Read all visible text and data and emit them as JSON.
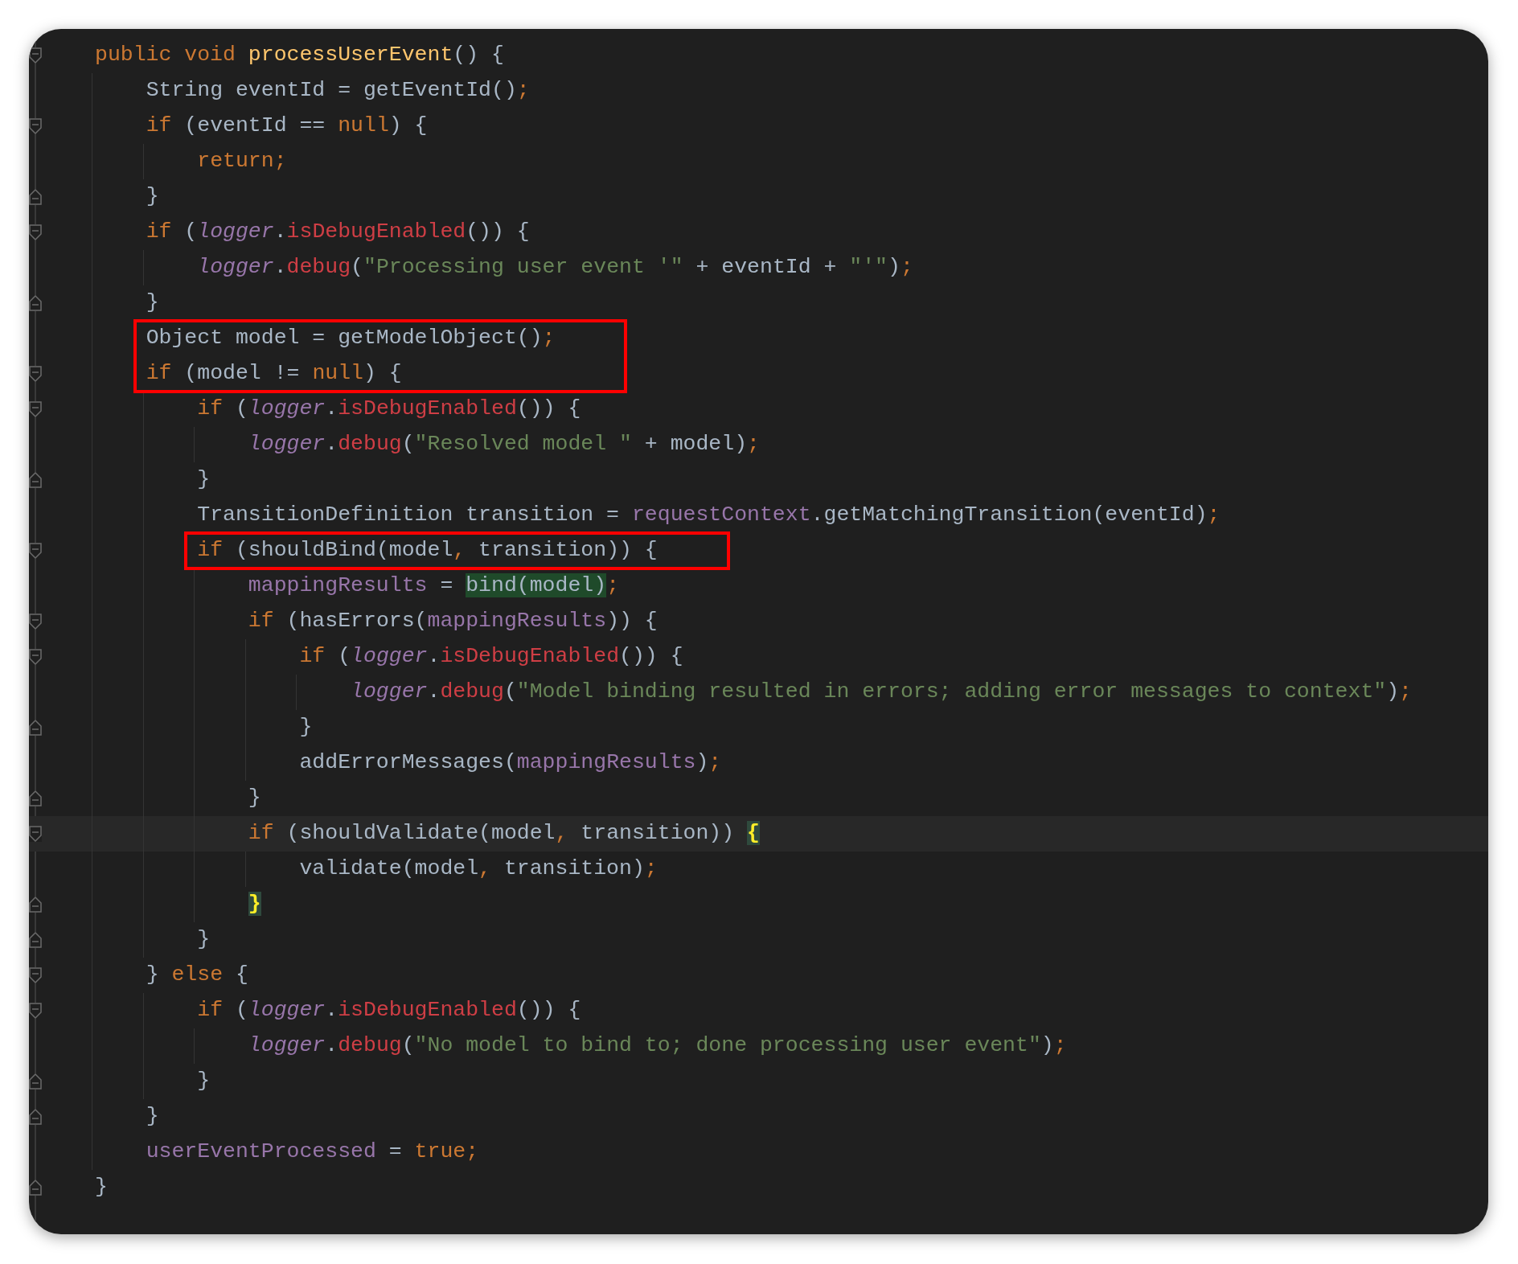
{
  "editor": {
    "lines": [
      {
        "fold_start": true,
        "fold_end": false,
        "boxed": false,
        "current": false,
        "tokens": [
          {
            "text": "public void ",
            "kind": "keyword"
          },
          {
            "text": "processUserEvent",
            "kind": "declaration"
          },
          {
            "text": "() {",
            "kind": "plain"
          }
        ]
      },
      {
        "fold_start": false,
        "fold_end": false,
        "boxed": false,
        "current": false,
        "tokens": [
          {
            "text": "    String eventId = getEventId()",
            "kind": "plain"
          },
          {
            "text": ";",
            "kind": "keyword"
          }
        ]
      },
      {
        "fold_start": true,
        "fold_end": false,
        "boxed": false,
        "current": false,
        "tokens": [
          {
            "text": "    if",
            "kind": "keyword"
          },
          {
            "text": " (eventId == ",
            "kind": "plain"
          },
          {
            "text": "null",
            "kind": "keyword"
          },
          {
            "text": ") {",
            "kind": "plain"
          }
        ]
      },
      {
        "fold_start": false,
        "fold_end": false,
        "boxed": false,
        "current": false,
        "tokens": [
          {
            "text": "        return;",
            "kind": "keyword"
          }
        ]
      },
      {
        "fold_start": false,
        "fold_end": true,
        "boxed": false,
        "current": false,
        "tokens": [
          {
            "text": "    }",
            "kind": "plain"
          }
        ]
      },
      {
        "fold_start": true,
        "fold_end": false,
        "boxed": false,
        "current": false,
        "tokens": [
          {
            "text": "    if",
            "kind": "keyword"
          },
          {
            "text": " (",
            "kind": "plain"
          },
          {
            "text": "logger",
            "kind": "static_field"
          },
          {
            "text": ".",
            "kind": "plain"
          },
          {
            "text": "isDebugEnabled",
            "kind": "call"
          },
          {
            "text": "()) {",
            "kind": "plain"
          }
        ]
      },
      {
        "fold_start": false,
        "fold_end": false,
        "boxed": false,
        "current": false,
        "tokens": [
          {
            "text": "        logger",
            "kind": "static_field"
          },
          {
            "text": ".",
            "kind": "plain"
          },
          {
            "text": "debug",
            "kind": "call"
          },
          {
            "text": "(",
            "kind": "plain"
          },
          {
            "text": "\"Processing user event '\"",
            "kind": "string"
          },
          {
            "text": " + eventId + ",
            "kind": "plain"
          },
          {
            "text": "\"'\"",
            "kind": "string"
          },
          {
            "text": ")",
            "kind": "plain"
          },
          {
            "text": ";",
            "kind": "keyword"
          }
        ]
      },
      {
        "fold_start": false,
        "fold_end": true,
        "boxed": false,
        "current": false,
        "tokens": [
          {
            "text": "    }",
            "kind": "plain"
          }
        ]
      },
      {
        "fold_start": false,
        "fold_end": false,
        "boxed": true,
        "current": false,
        "tokens": [
          {
            "text": "    Object model = getModelObject()",
            "kind": "plain"
          },
          {
            "text": ";",
            "kind": "keyword"
          }
        ]
      },
      {
        "fold_start": true,
        "fold_end": false,
        "boxed": true,
        "current": false,
        "tokens": [
          {
            "text": "    if",
            "kind": "keyword"
          },
          {
            "text": " (model != ",
            "kind": "plain"
          },
          {
            "text": "null",
            "kind": "keyword"
          },
          {
            "text": ") {",
            "kind": "plain"
          }
        ]
      },
      {
        "fold_start": true,
        "fold_end": false,
        "boxed": false,
        "current": false,
        "tokens": [
          {
            "text": "        if",
            "kind": "keyword"
          },
          {
            "text": " (",
            "kind": "plain"
          },
          {
            "text": "logger",
            "kind": "static_field"
          },
          {
            "text": ".",
            "kind": "plain"
          },
          {
            "text": "isDebugEnabled",
            "kind": "call"
          },
          {
            "text": "()) {",
            "kind": "plain"
          }
        ]
      },
      {
        "fold_start": false,
        "fold_end": false,
        "boxed": false,
        "current": false,
        "tokens": [
          {
            "text": "            logger",
            "kind": "static_field"
          },
          {
            "text": ".",
            "kind": "plain"
          },
          {
            "text": "debug",
            "kind": "call"
          },
          {
            "text": "(",
            "kind": "plain"
          },
          {
            "text": "\"Resolved model \"",
            "kind": "string"
          },
          {
            "text": " + model)",
            "kind": "plain"
          },
          {
            "text": ";",
            "kind": "keyword"
          }
        ]
      },
      {
        "fold_start": false,
        "fold_end": true,
        "boxed": false,
        "current": false,
        "tokens": [
          {
            "text": "        }",
            "kind": "plain"
          }
        ]
      },
      {
        "fold_start": false,
        "fold_end": false,
        "boxed": false,
        "current": false,
        "tokens": [
          {
            "text": "        TransitionDefinition transition = ",
            "kind": "plain"
          },
          {
            "text": "requestContext",
            "kind": "field"
          },
          {
            "text": ".getMatchingTransition(eventId)",
            "kind": "plain"
          },
          {
            "text": ";",
            "kind": "keyword"
          }
        ]
      },
      {
        "fold_start": true,
        "fold_end": false,
        "boxed": true,
        "current": false,
        "tokens": [
          {
            "text": "        if",
            "kind": "keyword"
          },
          {
            "text": " (shouldBind(model",
            "kind": "plain"
          },
          {
            "text": ",",
            "kind": "keyword"
          },
          {
            "text": " transition)) {",
            "kind": "plain"
          }
        ]
      },
      {
        "fold_start": false,
        "fold_end": false,
        "boxed": false,
        "current": false,
        "tokens": [
          {
            "text": "            mappingResults",
            "kind": "field"
          },
          {
            "text": " = ",
            "kind": "plain"
          },
          {
            "text": "bind(model)",
            "kind": "usage"
          },
          {
            "text": ";",
            "kind": "keyword"
          }
        ]
      },
      {
        "fold_start": true,
        "fold_end": false,
        "boxed": false,
        "current": false,
        "tokens": [
          {
            "text": "            if",
            "kind": "keyword"
          },
          {
            "text": " (hasErrors(",
            "kind": "plain"
          },
          {
            "text": "mappingResults",
            "kind": "field"
          },
          {
            "text": ")) {",
            "kind": "plain"
          }
        ]
      },
      {
        "fold_start": true,
        "fold_end": false,
        "boxed": false,
        "current": false,
        "tokens": [
          {
            "text": "                if",
            "kind": "keyword"
          },
          {
            "text": " (",
            "kind": "plain"
          },
          {
            "text": "logger",
            "kind": "static_field"
          },
          {
            "text": ".",
            "kind": "plain"
          },
          {
            "text": "isDebugEnabled",
            "kind": "call"
          },
          {
            "text": "()) {",
            "kind": "plain"
          }
        ]
      },
      {
        "fold_start": false,
        "fold_end": false,
        "boxed": false,
        "current": false,
        "tokens": [
          {
            "text": "                    logger",
            "kind": "static_field"
          },
          {
            "text": ".",
            "kind": "plain"
          },
          {
            "text": "debug",
            "kind": "call"
          },
          {
            "text": "(",
            "kind": "plain"
          },
          {
            "text": "\"Model binding resulted in errors; adding error messages to context\"",
            "kind": "string"
          },
          {
            "text": ")",
            "kind": "plain"
          },
          {
            "text": ";",
            "kind": "keyword"
          }
        ]
      },
      {
        "fold_start": false,
        "fold_end": true,
        "boxed": false,
        "current": false,
        "tokens": [
          {
            "text": "                }",
            "kind": "plain"
          }
        ]
      },
      {
        "fold_start": false,
        "fold_end": false,
        "boxed": false,
        "current": false,
        "tokens": [
          {
            "text": "                addErrorMessages(",
            "kind": "plain"
          },
          {
            "text": "mappingResults",
            "kind": "field"
          },
          {
            "text": ")",
            "kind": "plain"
          },
          {
            "text": ";",
            "kind": "keyword"
          }
        ]
      },
      {
        "fold_start": false,
        "fold_end": true,
        "boxed": false,
        "current": false,
        "tokens": [
          {
            "text": "            }",
            "kind": "plain"
          }
        ]
      },
      {
        "fold_start": true,
        "fold_end": false,
        "boxed": false,
        "current": true,
        "tokens": [
          {
            "text": "            if",
            "kind": "keyword"
          },
          {
            "text": " (shouldValidate(model",
            "kind": "plain"
          },
          {
            "text": ",",
            "kind": "keyword"
          },
          {
            "text": " transition)) ",
            "kind": "plain"
          },
          {
            "text": "{",
            "kind": "brace_match"
          }
        ]
      },
      {
        "fold_start": false,
        "fold_end": false,
        "boxed": false,
        "current": false,
        "tokens": [
          {
            "text": "                validate(model",
            "kind": "plain"
          },
          {
            "text": ",",
            "kind": "keyword"
          },
          {
            "text": " transition)",
            "kind": "plain"
          },
          {
            "text": ";",
            "kind": "keyword"
          }
        ]
      },
      {
        "fold_start": false,
        "fold_end": true,
        "boxed": false,
        "current": false,
        "tokens": [
          {
            "text": "            }",
            "kind": "brace_match"
          }
        ]
      },
      {
        "fold_start": false,
        "fold_end": true,
        "boxed": false,
        "current": false,
        "tokens": [
          {
            "text": "        }",
            "kind": "plain"
          }
        ]
      },
      {
        "fold_start": true,
        "fold_end": false,
        "boxed": false,
        "current": false,
        "tokens": [
          {
            "text": "    } ",
            "kind": "plain"
          },
          {
            "text": "else",
            "kind": "keyword"
          },
          {
            "text": " {",
            "kind": "plain"
          }
        ]
      },
      {
        "fold_start": true,
        "fold_end": false,
        "boxed": false,
        "current": false,
        "tokens": [
          {
            "text": "        if",
            "kind": "keyword"
          },
          {
            "text": " (",
            "kind": "plain"
          },
          {
            "text": "logger",
            "kind": "static_field"
          },
          {
            "text": ".",
            "kind": "plain"
          },
          {
            "text": "isDebugEnabled",
            "kind": "call"
          },
          {
            "text": "()) {",
            "kind": "plain"
          }
        ]
      },
      {
        "fold_start": false,
        "fold_end": false,
        "boxed": false,
        "current": false,
        "tokens": [
          {
            "text": "            logger",
            "kind": "static_field"
          },
          {
            "text": ".",
            "kind": "plain"
          },
          {
            "text": "debug",
            "kind": "call"
          },
          {
            "text": "(",
            "kind": "plain"
          },
          {
            "text": "\"No model to bind to; done processing user event\"",
            "kind": "string"
          },
          {
            "text": ")",
            "kind": "plain"
          },
          {
            "text": ";",
            "kind": "keyword"
          }
        ]
      },
      {
        "fold_start": false,
        "fold_end": true,
        "boxed": false,
        "current": false,
        "tokens": [
          {
            "text": "        }",
            "kind": "plain"
          }
        ]
      },
      {
        "fold_start": false,
        "fold_end": true,
        "boxed": false,
        "current": false,
        "tokens": [
          {
            "text": "    }",
            "kind": "plain"
          }
        ]
      },
      {
        "fold_start": false,
        "fold_end": false,
        "boxed": false,
        "current": false,
        "tokens": [
          {
            "text": "    userEventProcessed",
            "kind": "field"
          },
          {
            "text": " = ",
            "kind": "plain"
          },
          {
            "text": "true",
            "kind": "keyword"
          },
          {
            "text": ";",
            "kind": "keyword"
          }
        ]
      },
      {
        "fold_start": false,
        "fold_end": true,
        "boxed": false,
        "current": false,
        "tokens": [
          {
            "text": "}",
            "kind": "plain"
          }
        ]
      }
    ]
  }
}
